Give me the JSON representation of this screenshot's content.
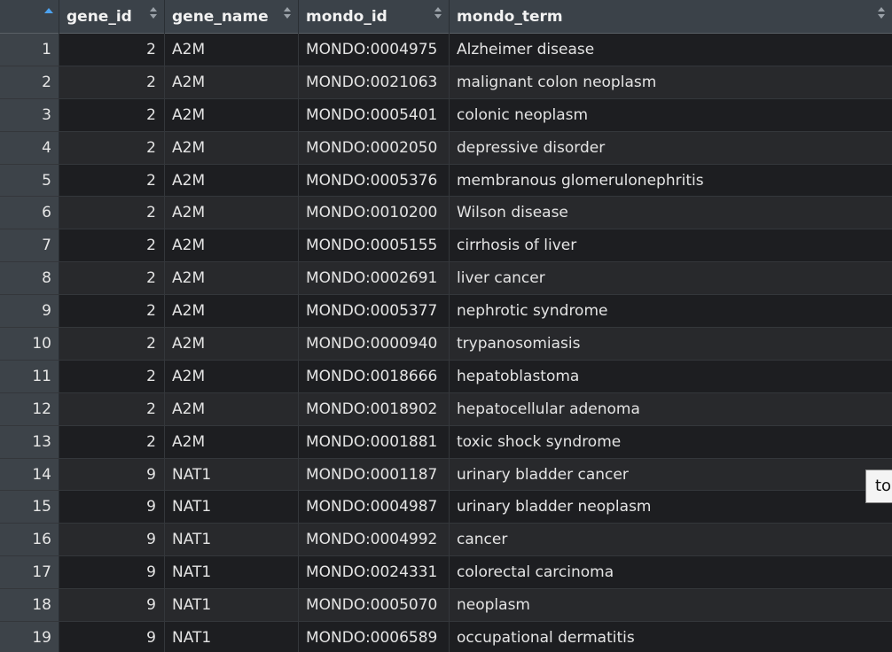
{
  "columns": {
    "gene_id": "gene_id",
    "gene_name": "gene_name",
    "mondo_id": "mondo_id",
    "mondo_term": "mondo_term"
  },
  "rows": [
    {
      "index": "1",
      "gene_id": "2",
      "gene_name": "A2M",
      "mondo_id": "MONDO:0004975",
      "mondo_term": "Alzheimer disease"
    },
    {
      "index": "2",
      "gene_id": "2",
      "gene_name": "A2M",
      "mondo_id": "MONDO:0021063",
      "mondo_term": "malignant colon neoplasm"
    },
    {
      "index": "3",
      "gene_id": "2",
      "gene_name": "A2M",
      "mondo_id": "MONDO:0005401",
      "mondo_term": "colonic neoplasm"
    },
    {
      "index": "4",
      "gene_id": "2",
      "gene_name": "A2M",
      "mondo_id": "MONDO:0002050",
      "mondo_term": "depressive disorder"
    },
    {
      "index": "5",
      "gene_id": "2",
      "gene_name": "A2M",
      "mondo_id": "MONDO:0005376",
      "mondo_term": "membranous glomerulonephritis"
    },
    {
      "index": "6",
      "gene_id": "2",
      "gene_name": "A2M",
      "mondo_id": "MONDO:0010200",
      "mondo_term": "Wilson disease"
    },
    {
      "index": "7",
      "gene_id": "2",
      "gene_name": "A2M",
      "mondo_id": "MONDO:0005155",
      "mondo_term": "cirrhosis of liver"
    },
    {
      "index": "8",
      "gene_id": "2",
      "gene_name": "A2M",
      "mondo_id": "MONDO:0002691",
      "mondo_term": "liver cancer"
    },
    {
      "index": "9",
      "gene_id": "2",
      "gene_name": "A2M",
      "mondo_id": "MONDO:0005377",
      "mondo_term": "nephrotic syndrome"
    },
    {
      "index": "10",
      "gene_id": "2",
      "gene_name": "A2M",
      "mondo_id": "MONDO:0000940",
      "mondo_term": "trypanosomiasis"
    },
    {
      "index": "11",
      "gene_id": "2",
      "gene_name": "A2M",
      "mondo_id": "MONDO:0018666",
      "mondo_term": "hepatoblastoma"
    },
    {
      "index": "12",
      "gene_id": "2",
      "gene_name": "A2M",
      "mondo_id": "MONDO:0018902",
      "mondo_term": "hepatocellular adenoma"
    },
    {
      "index": "13",
      "gene_id": "2",
      "gene_name": "A2M",
      "mondo_id": "MONDO:0001881",
      "mondo_term": "toxic shock syndrome"
    },
    {
      "index": "14",
      "gene_id": "9",
      "gene_name": "NAT1",
      "mondo_id": "MONDO:0001187",
      "mondo_term": "urinary bladder cancer"
    },
    {
      "index": "15",
      "gene_id": "9",
      "gene_name": "NAT1",
      "mondo_id": "MONDO:0004987",
      "mondo_term": "urinary bladder neoplasm"
    },
    {
      "index": "16",
      "gene_id": "9",
      "gene_name": "NAT1",
      "mondo_id": "MONDO:0004992",
      "mondo_term": "cancer"
    },
    {
      "index": "17",
      "gene_id": "9",
      "gene_name": "NAT1",
      "mondo_id": "MONDO:0024331",
      "mondo_term": "colorectal carcinoma"
    },
    {
      "index": "18",
      "gene_id": "9",
      "gene_name": "NAT1",
      "mondo_id": "MONDO:0005070",
      "mondo_term": "neoplasm"
    },
    {
      "index": "19",
      "gene_id": "9",
      "gene_name": "NAT1",
      "mondo_id": "MONDO:0006589",
      "mondo_term": "occupational dermatitis"
    }
  ],
  "tooltip": {
    "text": "to"
  },
  "sort": {
    "active_column": "index",
    "direction": "ascending"
  },
  "icons": {
    "sort_ascending": "sort-ascending-icon",
    "sort_both": "sort-both-icon"
  },
  "colors": {
    "header_bg": "#3b4249",
    "row_odd": "#1d1e21",
    "row_even": "#28292c",
    "sort_accent": "#4da3f0"
  }
}
